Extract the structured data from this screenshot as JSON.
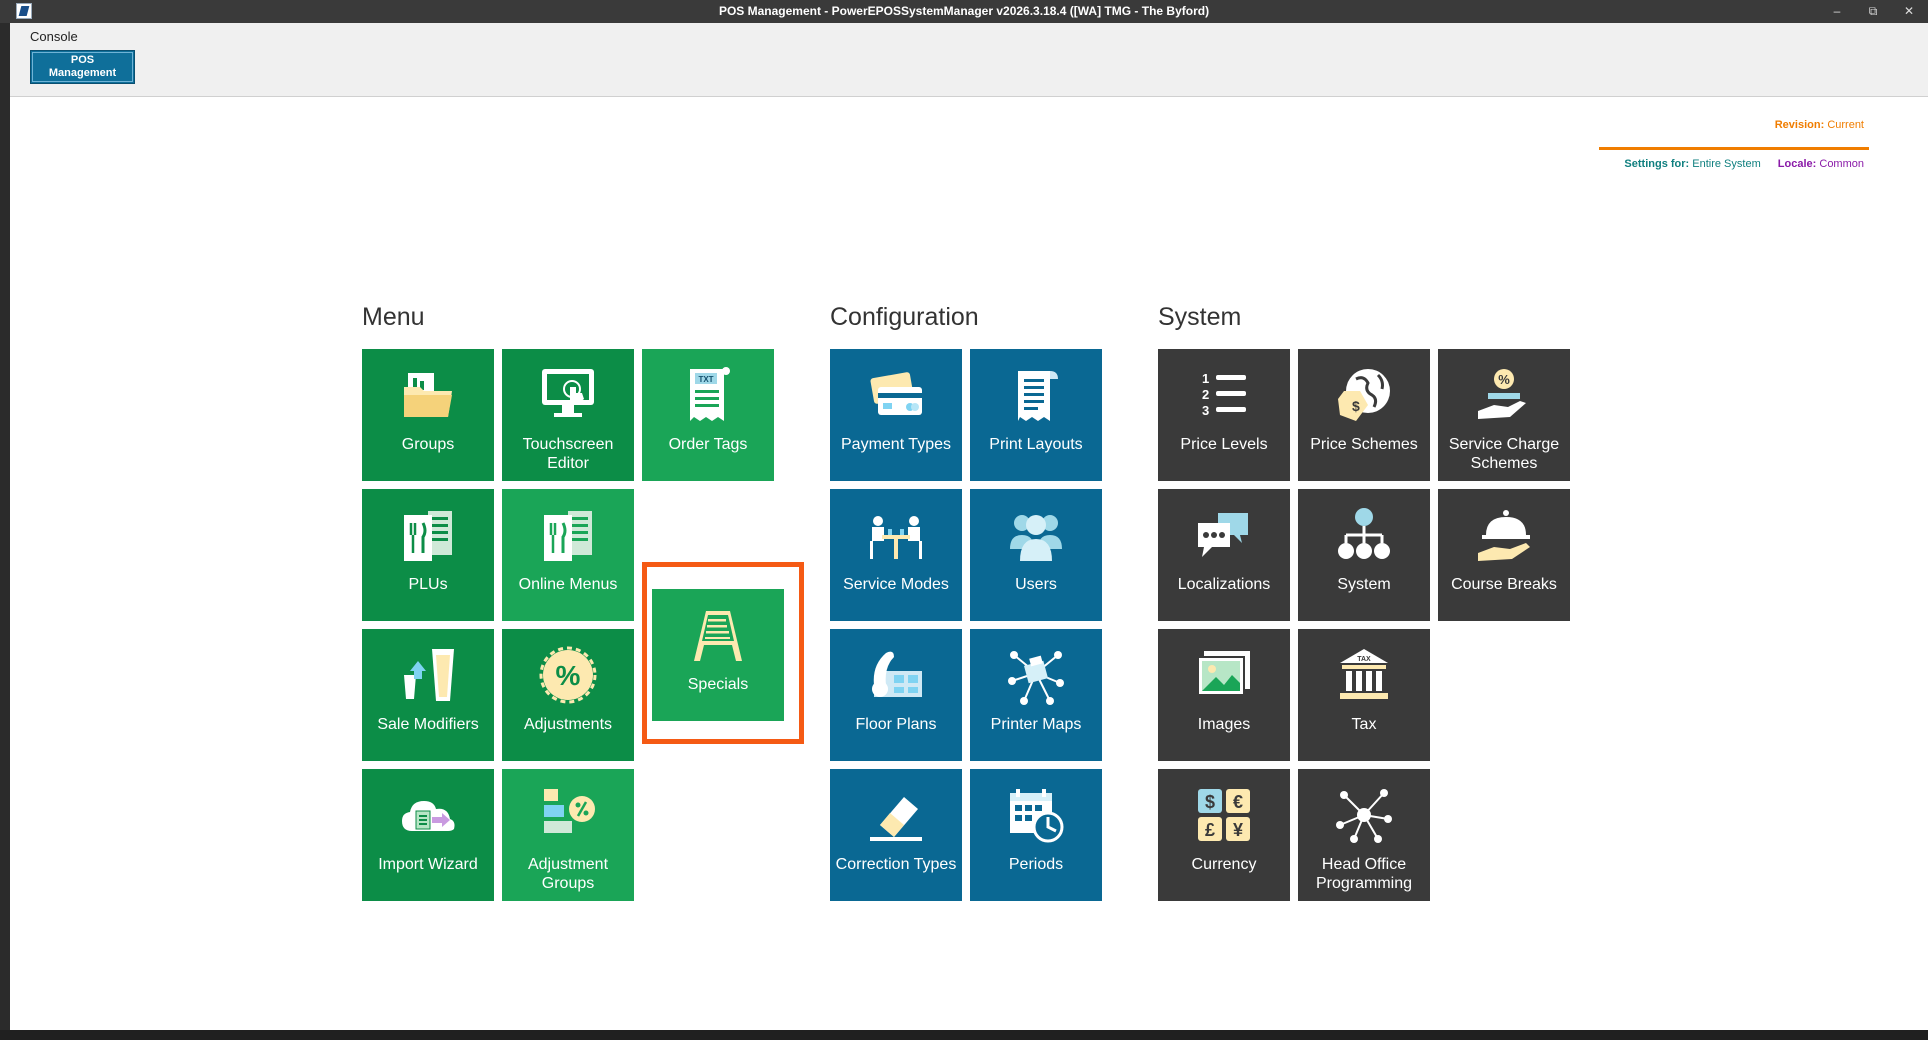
{
  "window": {
    "title": "POS Management - PowerEPOSSystemManager v2026.3.18.4 ([WA] TMG - The Byford)",
    "minimize": "–",
    "restore": "⧉",
    "close": "✕"
  },
  "ribbon": {
    "tab": "Console",
    "button_line1": "POS",
    "button_line2": "Management"
  },
  "header": {
    "revision_label": "Revision:",
    "revision_value": "Current",
    "settings_label": "Settings for:",
    "settings_value": "Entire System",
    "locale_label": "Locale:",
    "locale_value": "Common"
  },
  "sections": {
    "menu": "Menu",
    "configuration": "Configuration",
    "system": "System"
  },
  "menu": {
    "groups": "Groups",
    "touchscreen_editor": "Touchscreen Editor",
    "order_tags": "Order Tags",
    "plus": "PLUs",
    "online_menus": "Online Menus",
    "specials": "Specials",
    "sale_modifiers": "Sale Modifiers",
    "adjustments": "Adjustments",
    "import_wizard": "Import Wizard",
    "adjustment_groups": "Adjustment Groups"
  },
  "configuration": {
    "payment_types": "Payment Types",
    "print_layouts": "Print Layouts",
    "service_modes": "Service Modes",
    "users": "Users",
    "floor_plans": "Floor Plans",
    "printer_maps": "Printer Maps",
    "correction_types": "Correction Types",
    "periods": "Periods"
  },
  "system": {
    "price_levels": "Price Levels",
    "price_schemes": "Price Schemes",
    "service_charge_schemes": "Service Charge Schemes",
    "localizations": "Localizations",
    "system": "System",
    "course_breaks": "Course Breaks",
    "images": "Images",
    "tax": "Tax",
    "currency": "Currency",
    "head_office_programming": "Head Office Programming"
  },
  "icon_text": {
    "order_tags_tag": "TXT",
    "price_levels_nums": [
      "1",
      "2",
      "3"
    ],
    "tax_tag": "TAX",
    "adjustments_sym": "%",
    "currency_syms": [
      "$",
      "€",
      "£",
      "¥"
    ]
  },
  "colors": {
    "menu_tile": "#0c8d47",
    "config_tile": "#0a6893",
    "system_tile": "#3a3a3a",
    "highlight": "#f55a14",
    "revision": "#f07d00"
  }
}
